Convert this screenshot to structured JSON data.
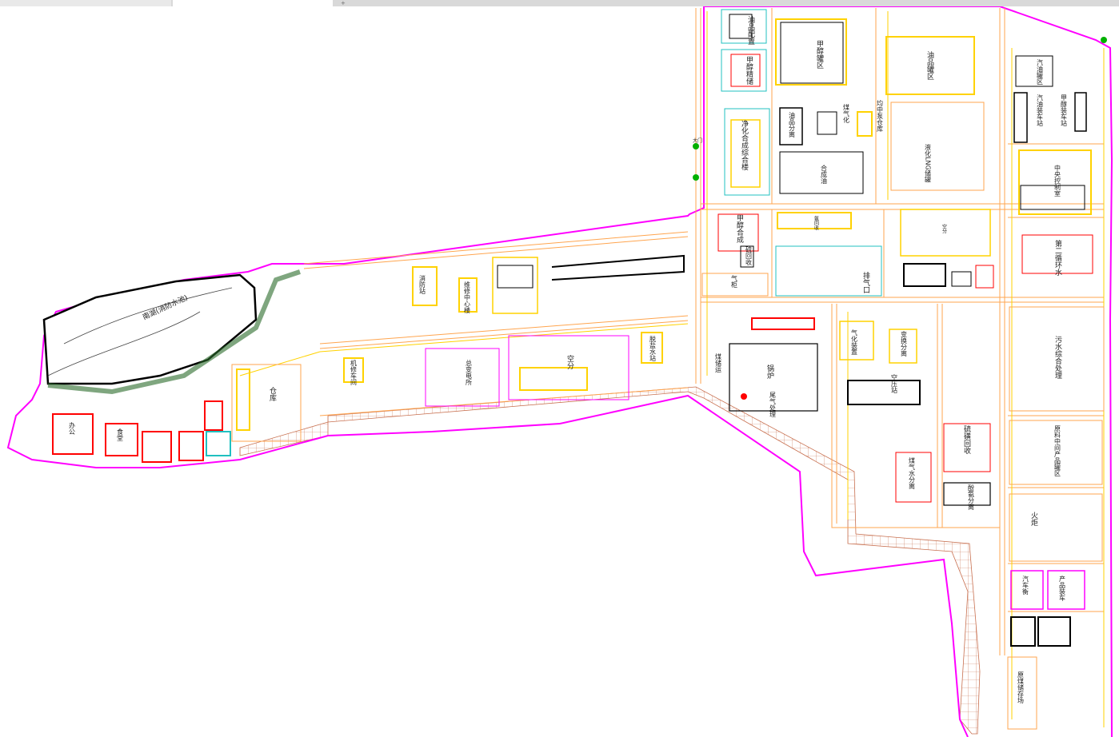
{
  "tabs": [
    "",
    ""
  ],
  "new_tab_glyph": "+",
  "colors": {
    "boundary": "#ff00ff",
    "road": "#ffa54f",
    "pipe": "#ffd200",
    "highlight": "#ffff00",
    "alert": "#ff0000",
    "cyan": "#20c0c0",
    "green": "#00b000",
    "dark": "#000000",
    "hatch": "#c87050"
  },
  "plan": {
    "labels": {
      "oil_sep": "油品配置",
      "methanol_tank": "甲醇罐区",
      "oil_tank": "油品罐区",
      "gasoline_loading": "汽油罐区",
      "methanol_storage": "甲醇精储",
      "oil_separation": "油品分离",
      "coal_water": "煤气化",
      "pump_house": "均中泵仓库",
      "lng_tank": "液化LNG储罐",
      "loading_station": "汽油装车站",
      "gas_station": "甲醇装车站",
      "hydrogen": "净化合成综合楼",
      "synthesis": "合成油",
      "center": "中央控制室",
      "methanol_synth": "甲醇合成",
      "ammonia": "硫回收",
      "deoxidizer": "氨回收",
      "water_circ": "第二循环水",
      "air_sep": "空分",
      "gas_line": "气柜",
      "exhaust": "排气口",
      "fire_station": "消防站",
      "maintenance": "维修中心楼",
      "warehouse": "仓库",
      "workshop": "机修车间",
      "power": "总变电所",
      "boiler": "锅炉",
      "coal_yard": "煤储运",
      "desalt": "脱盐水站",
      "sewage": "污水综合处理",
      "tail_gas": "尾气处理",
      "gas_proc": "气化装置",
      "crude_sep": "变换分离",
      "air_comp": "空压站",
      "raw_tank": "原料中间产品罐区",
      "sulfur": "硫磺回收",
      "gasify": "煤气水分离",
      "separate": "酚氨分离",
      "torch": "火炬",
      "auto_station": "汽车衡",
      "product_loading": "产品装车",
      "dispatch": "调度楼",
      "gate": "大门",
      "office": "办公",
      "canteen": "食堂",
      "dorm": "宿舍",
      "reservoir": "南湖(消防水池)",
      "coal_storage": "原煤储存场",
      "railway": "铁路装卸",
      "water_treat": "给水处理",
      "circ1": "第一循环水",
      "lab": "化验室",
      "substation": "变电所"
    }
  }
}
